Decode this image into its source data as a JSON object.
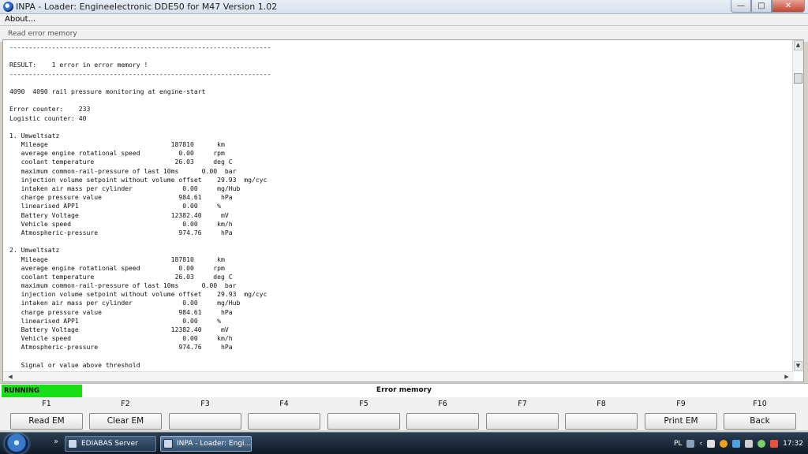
{
  "window": {
    "title": "INPA - Loader:  Engineelectronic DDE50 for M47 Version 1.02",
    "minimize": "—",
    "maximize": "□",
    "close": "✕"
  },
  "menu": {
    "about": "About..."
  },
  "sub_label": "Read error memory",
  "text_lines": [
    "--------------------------------------------------------------------",
    "",
    "RESULT:    1 error in error memory !",
    "--------------------------------------------------------------------",
    "",
    "4090  4090 rail pressure monitoring at engine-start",
    "",
    "Error counter:    233",
    "Logistic counter: 40",
    "",
    "1. Umweltsatz",
    "   Mileage                                187810      km",
    "   average engine rotational speed          0.00     rpm",
    "   coolant temperature                     26.03     deg C",
    "   maximum common-rail-pressure of last 10ms      0.00  bar",
    "   injection volume setpoint without volume offset    29.93  mg/cyc",
    "   intaken air mass per cylinder             0.00     mg/Hub",
    "   charge pressure value                    984.61     hPa",
    "   linearised APP1                           0.00     %",
    "   Battery Voltage                        12382.40     mV",
    "   Vehicle speed                             0.00     km/h",
    "   Atmospheric-pressure                     974.76     hPa",
    "",
    "2. Umweltsatz",
    "   Mileage                                187810      km",
    "   average engine rotational speed          0.00     rpm",
    "   coolant temperature                     26.03     deg C",
    "   maximum common-rail-pressure of last 10ms      0.00  bar",
    "   injection volume setpoint without volume offset    29.93  mg/cyc",
    "   intaken air mass per cylinder             0.00     mg/Hub",
    "   charge pressure value                    984.61     hPa",
    "   linearised APP1                           0.00     %",
    "   Battery Voltage                        12382.40     mV",
    "   Vehicle speed                             0.00     km/h",
    "   Atmospheric-pressure                     974.76     hPa",
    "",
    "   Signal or value above threshold"
  ],
  "status": {
    "running": "RUNNING",
    "screen_title": "Error memory",
    "running_color": "#18e018"
  },
  "fkeys": [
    {
      "key": "F1",
      "label": "Read EM"
    },
    {
      "key": "F2",
      "label": "Clear EM"
    },
    {
      "key": "F3",
      "label": ""
    },
    {
      "key": "F4",
      "label": ""
    },
    {
      "key": "F5",
      "label": ""
    },
    {
      "key": "F6",
      "label": ""
    },
    {
      "key": "F7",
      "label": ""
    },
    {
      "key": "F8",
      "label": ""
    },
    {
      "key": "F9",
      "label": "Print EM"
    },
    {
      "key": "F10",
      "label": "Back"
    }
  ],
  "taskbar": {
    "items": [
      {
        "label": "EDIABAS Server",
        "active": false
      },
      {
        "label": "INPA - Loader:  Engi...",
        "active": true
      }
    ],
    "language": "PL",
    "clock": "17:32"
  }
}
